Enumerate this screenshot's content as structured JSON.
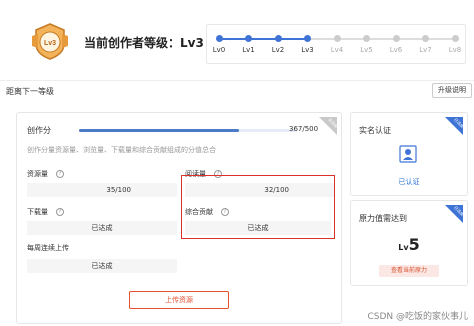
{
  "header": {
    "badge_text": "Lv3",
    "title": "当前创作者等级：Lv3",
    "levels": [
      {
        "label": "Lv0",
        "reached": true
      },
      {
        "label": "Lv1",
        "reached": true
      },
      {
        "label": "Lv2",
        "reached": true
      },
      {
        "label": "Lv3",
        "reached": true
      },
      {
        "label": "Lv4",
        "reached": false
      },
      {
        "label": "Lv5",
        "reached": false
      },
      {
        "label": "Lv6",
        "reached": false
      },
      {
        "label": "Lv7",
        "reached": false
      },
      {
        "label": "Lv8",
        "reached": false
      }
    ]
  },
  "next_level_label": "距离下一等级",
  "upgrade_button": "升级说明",
  "main": {
    "create_label": "创作分",
    "progress": {
      "value": 367,
      "max": 500,
      "text": "367/500"
    },
    "corner_tag_text": "未达成",
    "description": "创作分量资源量、浏览量、下载量和综合贡献组成的分值总合",
    "metrics": {
      "resources": {
        "label": "资源量",
        "value": "35/100"
      },
      "views": {
        "label": "阅读量",
        "value": "32/100"
      },
      "downloads": {
        "label": "下载量",
        "value": "已达成"
      },
      "contribution": {
        "label": "综合贡献",
        "value": "已达成"
      },
      "weekly": {
        "label": "每周连续上传",
        "value": "已达成"
      }
    },
    "upload_button": "上传资源"
  },
  "verify": {
    "title": "实名认证",
    "corner_tag_text": "已达成",
    "status": "已认证"
  },
  "power": {
    "title": "原力值需达到",
    "corner_tag_text": "已达成",
    "level_prefix": "Lv",
    "level_number": "5",
    "button": "查看当前原力"
  },
  "watermark": "CSDN @吃饭的家伙事儿",
  "colors": {
    "accent": "#4a79c7",
    "highlight": "#d9312b",
    "orange": "#e8502f",
    "badge": "#e69a3c"
  }
}
